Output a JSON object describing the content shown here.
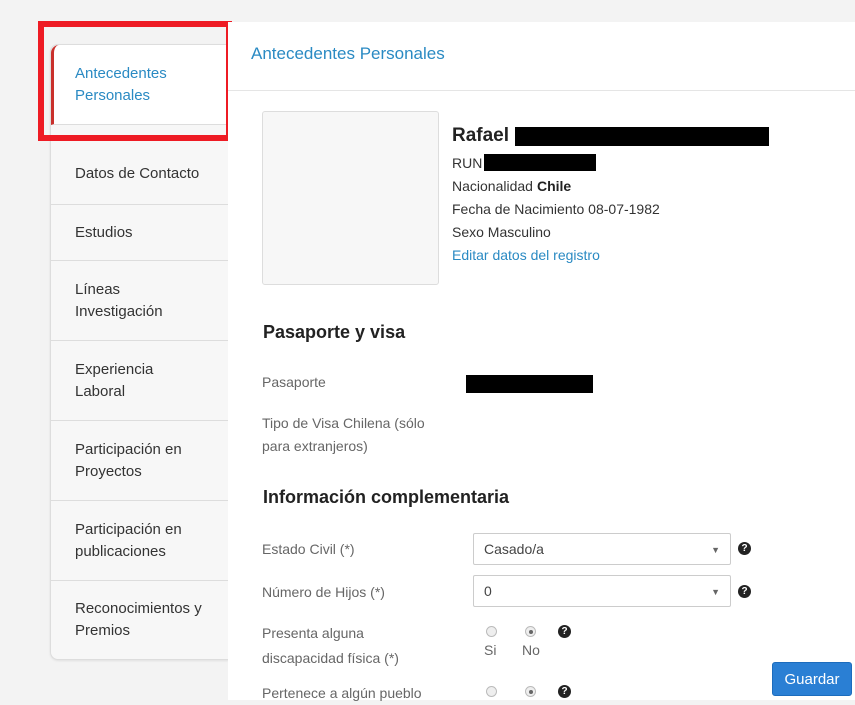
{
  "sidebar": {
    "items": [
      {
        "label": "Antecedentes Personales"
      },
      {
        "label": "Datos de Contacto"
      },
      {
        "label": "Estudios"
      },
      {
        "label": "Líneas Investigación"
      },
      {
        "label": "Experiencia Laboral"
      },
      {
        "label": "Participación en Proyectos"
      },
      {
        "label": "Participación en publicaciones"
      },
      {
        "label": "Reconocimientos y Premios"
      }
    ]
  },
  "main": {
    "title": "Antecedentes Personales",
    "profile": {
      "name": "Rafael",
      "run_label": "RUN",
      "nationality_label": "Nacionalidad",
      "nationality_value": "Chile",
      "birth": "Fecha de Nacimiento 08-07-1982",
      "sex": "Sexo Masculino",
      "edit_link": "Editar datos del registro"
    },
    "passport_section": {
      "title": "Pasaporte y visa",
      "passport_label": "Pasaporte",
      "visa_label_line1": "Tipo de Visa Chilena (sólo",
      "visa_label_line2": "para extranjeros)"
    },
    "complementary": {
      "title": "Información complementaria",
      "civil_label": "Estado Civil (*)",
      "civil_value": "Casado/a",
      "children_label": "Número de Hijos (*)",
      "children_value": "0",
      "disability_line1": "Presenta alguna",
      "disability_line2": "discapacidad física (*)",
      "radio_yes": "Si",
      "radio_no": "No",
      "indigenous_line1": "Pertenece a algún pueblo"
    },
    "save_label": "Guardar"
  }
}
